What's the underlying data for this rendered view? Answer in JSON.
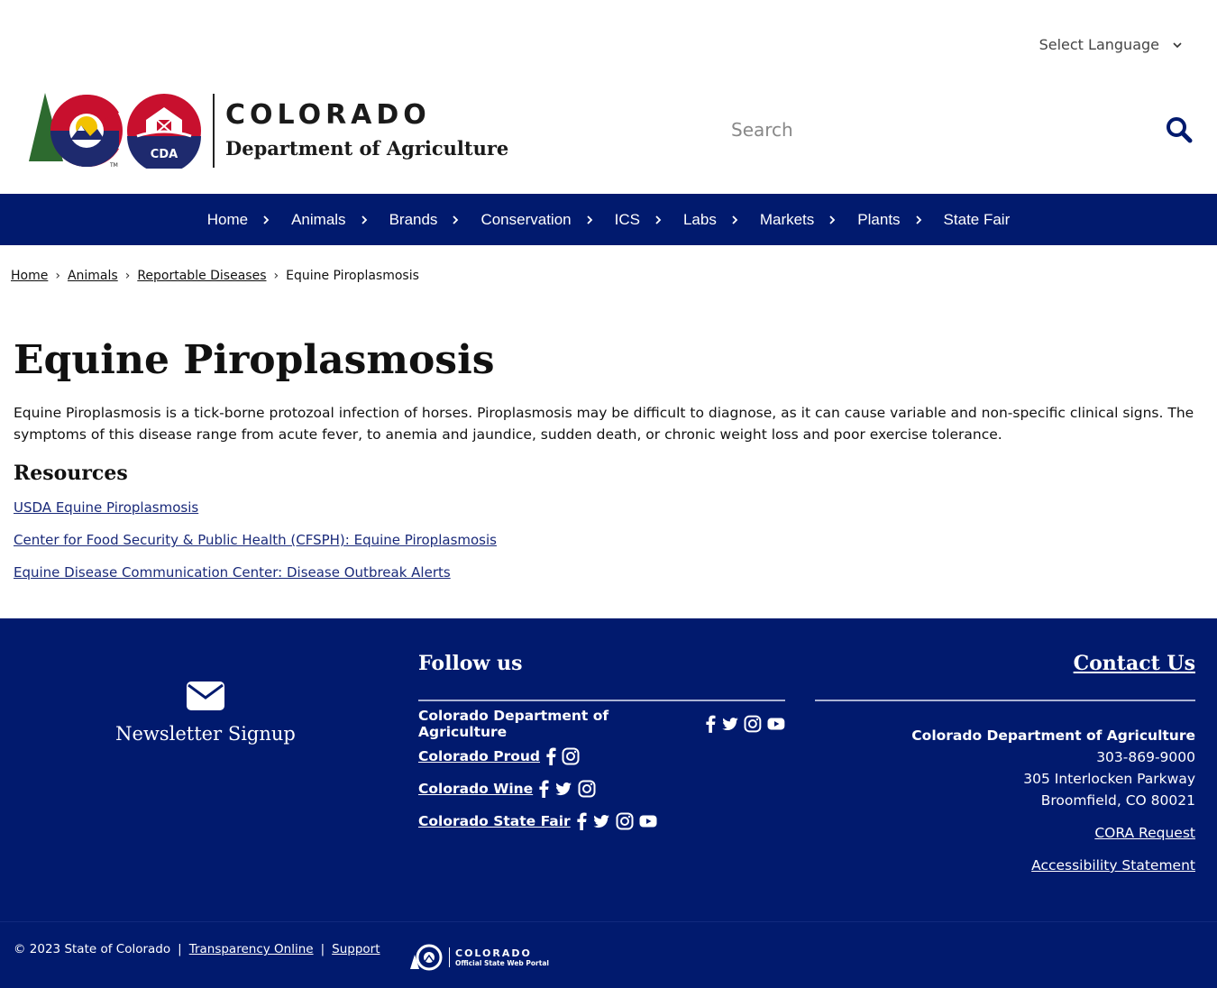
{
  "header": {
    "language_select": "Select Language",
    "logo_title": "COLORADO",
    "logo_subtitle": "Department of Agriculture",
    "logo_cda": "CDA",
    "search_placeholder": "Search"
  },
  "nav": {
    "items": [
      "Home",
      "Animals",
      "Brands",
      "Conservation",
      "ICS",
      "Labs",
      "Markets",
      "Plants",
      "State Fair"
    ]
  },
  "breadcrumb": {
    "items": [
      "Home",
      "Animals",
      "Reportable Diseases"
    ],
    "current": "Equine Piroplasmosis",
    "separator": "›"
  },
  "main": {
    "title": "Equine Piroplasmosis",
    "intro": "Equine Piroplasmosis is a tick-borne protozoal infection of horses. Piroplasmosis may be difficult to diagnose, as it can cause variable and non-specific clinical signs. The symptoms of this disease range from acute fever, to anemia and jaundice, sudden death, or chronic weight loss and poor exercise tolerance.",
    "resources_heading": "Resources",
    "resources": [
      "USDA Equine Piroplasmosis",
      "Center for Food Security & Public Health (CFSPH): Equine Piroplasmosis",
      "Equine Disease Communication Center: Disease Outbreak Alerts"
    ]
  },
  "footer": {
    "newsletter_label": "Newsletter Signup",
    "follow_heading": "Follow us",
    "social": [
      {
        "label": "Colorado Department of Agriculture",
        "icons": [
          "facebook-icon",
          "twitter-icon",
          "instagram-icon",
          "youtube-icon"
        ]
      },
      {
        "label": "Colorado Proud",
        "icons": [
          "facebook-icon",
          "instagram-icon"
        ]
      },
      {
        "label": "Colorado Wine",
        "icons": [
          "facebook-icon",
          "twitter-icon",
          "instagram-icon"
        ]
      },
      {
        "label": "Colorado State Fair",
        "icons": [
          "facebook-icon",
          "twitter-icon",
          "instagram-icon",
          "youtube-icon"
        ]
      }
    ],
    "contact_heading": "Contact Us",
    "contact_org": "Colorado Department of Agriculture",
    "contact_phone": "303-869-9000",
    "contact_address1": "305 Interlocken Parkway",
    "contact_address2": "Broomfield, CO 80021",
    "cora_link": "CORA Request",
    "accessibility_link": "Accessibility Statement"
  },
  "bottom": {
    "copyright": "© 2023 State of Colorado",
    "transparency": "Transparency Online",
    "support": "Support",
    "pipe": "|",
    "portal_title": "COLORADO",
    "portal_sub": "Official State Web Portal"
  },
  "colors": {
    "nav_bg": "#011a6e",
    "footer_bg": "#011a6e",
    "link": "#1a2a7a",
    "co_red": "#c8102e",
    "co_blue": "#1e2a6e",
    "co_gold": "#f2c200"
  }
}
